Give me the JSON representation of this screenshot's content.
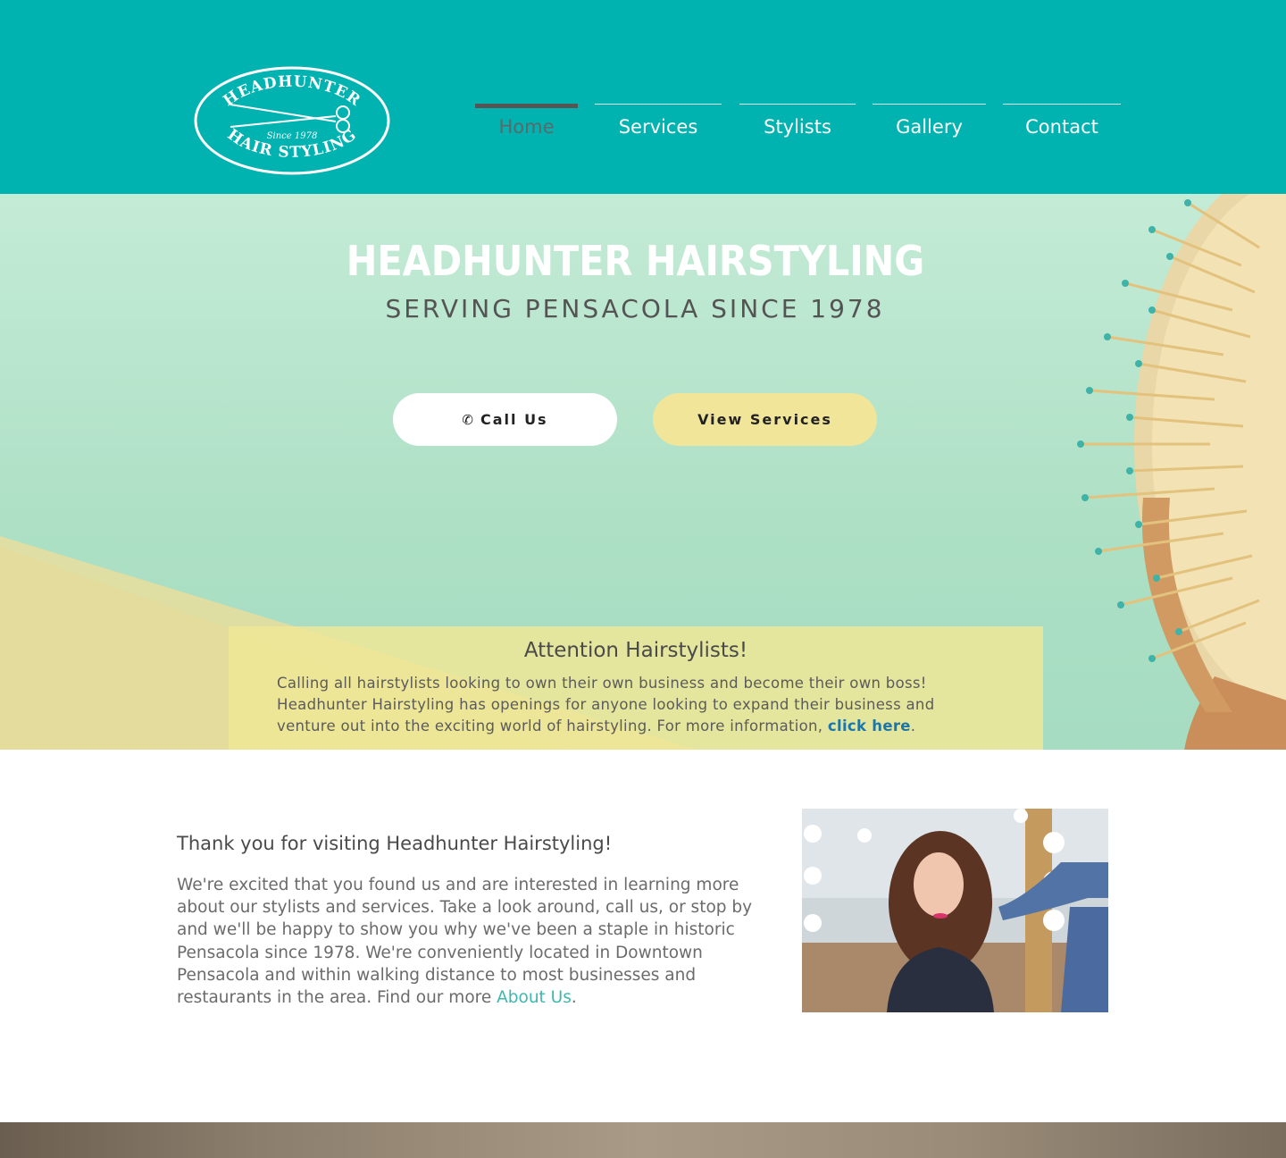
{
  "header": {
    "logo": {
      "top_text": "HEADHUNTER",
      "since": "Since 1978",
      "bottom_text": "HAIR STYLING"
    },
    "nav": [
      {
        "label": "Home",
        "active": true
      },
      {
        "label": "Services",
        "active": false
      },
      {
        "label": "Stylists",
        "active": false
      },
      {
        "label": "Gallery",
        "active": false
      },
      {
        "label": "Contact",
        "active": false
      }
    ]
  },
  "hero": {
    "title": "HEADHUNTER HAIRSTYLING",
    "subtitle": "SERVING PENSACOLA SINCE 1978",
    "call_button": "Call Us",
    "services_button": "View Services"
  },
  "attention": {
    "heading": "Attention Hairstylists!",
    "text": "Calling all hairstylists looking to own their own business and become their own boss! Headhunter Hairstyling has openings for anyone looking to expand their business and venture out into the exciting world of hairstyling. For more information, ",
    "link": "click here",
    "end": "."
  },
  "welcome": {
    "heading": "Thank you for visiting Headhunter Hairstyling!",
    "text": "We're excited that you found us and are interested in learning more about our stylists and services. Take a look around, call us, or stop by and we'll be happy to show you why we've been a staple in historic Pensacola since 1978. We're conveniently located in Downtown Pensacola and within walking distance to most businesses and restaurants in the area. Find our more ",
    "link": "About Us",
    "end": "."
  },
  "colors": {
    "header_bg": "#00b2b0",
    "hero_bg": "#ade0c5",
    "attention_bg": "#f0e896",
    "button_yellow": "#f1e59a",
    "link_blue": "#1d76a8",
    "link_teal": "#3fb7ad"
  }
}
